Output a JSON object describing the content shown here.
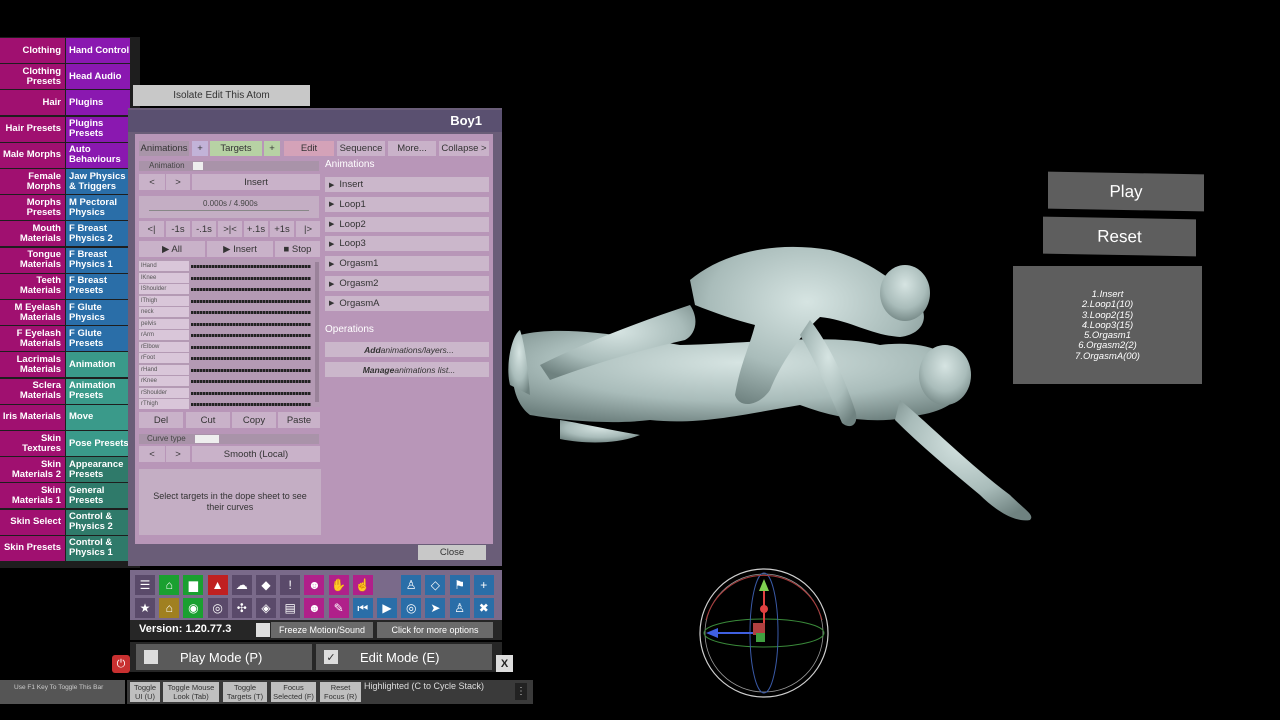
{
  "category_menu": [
    {
      "left": "Clothing",
      "right": "Hand Control",
      "right_color": "#8a18b0"
    },
    {
      "left": "Clothing Presets",
      "right": "Head Audio",
      "right_color": "#8a18b0"
    },
    {
      "left": "Hair",
      "right": "Plugins",
      "right_color": "#8a18b0"
    },
    {
      "left": "Hair Presets",
      "right": "Plugins Presets",
      "right_color": "#8a18b0"
    },
    {
      "left": "Male Morphs",
      "right": "Auto Behaviours",
      "right_color": "#8a18b0"
    },
    {
      "left": "Female Morphs",
      "right": "Jaw Physics & Triggers",
      "right_color": "#2a6ea8"
    },
    {
      "left": "Morphs Presets",
      "right": "M Pectoral Physics",
      "right_color": "#2a6ea8"
    },
    {
      "left": "Mouth Materials",
      "right": "F Breast Physics 2",
      "right_color": "#2a6ea8"
    },
    {
      "left": "Tongue Materials",
      "right": "F Breast Physics 1",
      "right_color": "#2a6ea8"
    },
    {
      "left": "Teeth Materials",
      "right": "F Breast Presets",
      "right_color": "#2a6ea8"
    },
    {
      "left": "M Eyelash Materials",
      "right": "F Glute Physics",
      "right_color": "#2a6ea8"
    },
    {
      "left": "F Eyelash Materials",
      "right": "F Glute Presets",
      "right_color": "#2a6ea8"
    },
    {
      "left": "Lacrimals Materials",
      "right": "Animation",
      "right_color": "#3a9a8a"
    },
    {
      "left": "Sclera Materials",
      "right": "Animation Presets",
      "right_color": "#3a9a8a"
    },
    {
      "left": "Iris Materials",
      "right": "Move",
      "right_color": "#3a9a8a"
    },
    {
      "left": "Skin Textures",
      "right": "Pose Presets",
      "right_color": "#3a9a8a"
    },
    {
      "left": "Skin Materials 2",
      "right": "Appearance Presets",
      "right_color": "#2f7a6a"
    },
    {
      "left": "Skin Materials 1",
      "right": "General Presets",
      "right_color": "#2f7a6a"
    },
    {
      "left": "Skin Select",
      "right": "Control & Physics 2",
      "right_color": "#2f7a6a"
    },
    {
      "left": "Skin Presets",
      "right": "Control & Physics 1",
      "right_color": "#2f7a6a"
    }
  ],
  "isolate_label": "Isolate Edit This Atom",
  "panel": {
    "title": "Boy1",
    "tabs": [
      "Animations",
      "+",
      "Targets",
      "+",
      "Edit",
      "Sequence",
      "More...",
      "Collapse >"
    ],
    "animation_label": "Animation",
    "prev": "<",
    "next": ">",
    "insert": "Insert",
    "time": "0.000s / 4.900s",
    "scrub_buttons": [
      "<|",
      "-1s",
      "-.1s",
      ">|<",
      "+.1s",
      "+1s",
      "|>"
    ],
    "play_all": "▶ All",
    "play_insert": "▶ Insert",
    "stop": "■ Stop",
    "dope_rows": [
      "lHand",
      "lKnee",
      "lShoulder",
      "lThigh",
      "neck",
      "pelvis",
      "rArm",
      "rElbow",
      "rFoot",
      "rHand",
      "rKnee",
      "rShoulder",
      "rThigh"
    ],
    "edit_buttons": [
      "Del",
      "Cut",
      "Copy",
      "Paste"
    ],
    "curve_type_label": "Curve type",
    "curve_value": "Smooth (Local)",
    "info_text": "Select targets in the dope sheet to see their curves",
    "animations_heading": "Animations",
    "animations": [
      "Insert",
      "Loop1",
      "Loop2",
      "Loop3",
      "Orgasm1",
      "Orgasm2",
      "OrgasmA"
    ],
    "operations_heading": "Operations",
    "op_add_em": "Add",
    "op_add_rest": " animations/layers...",
    "op_manage_em": "Manage",
    "op_manage_rest": " animations list...",
    "close": "Close"
  },
  "toolbar": {
    "row1": [
      {
        "name": "menu-icon",
        "glyph": "☰",
        "color": "#5a4a6a"
      },
      {
        "name": "open-scene-icon",
        "glyph": "⌂",
        "color": "#1aa030"
      },
      {
        "name": "folder-icon",
        "glyph": "▆",
        "color": "#1aa030"
      },
      {
        "name": "load-red-icon",
        "glyph": "▲",
        "color": "#c02020"
      },
      {
        "name": "cloud-icon",
        "glyph": "☁",
        "color": "#5a4a6a"
      },
      {
        "name": "cube-icon",
        "glyph": "◆",
        "color": "#5a4a6a"
      },
      {
        "name": "alert-icon",
        "glyph": "!",
        "color": "#5a4a6a"
      },
      {
        "name": "person-select-icon",
        "glyph": "☻",
        "color": "#b0208a"
      },
      {
        "name": "hand-icon",
        "glyph": "✋",
        "color": "#b0208a"
      },
      {
        "name": "pointer-hand-icon",
        "glyph": "☝",
        "color": "#b0208a"
      },
      {
        "name": "spacer",
        "glyph": "",
        "color": "transparent"
      },
      {
        "name": "person-icon",
        "glyph": "♙",
        "color": "#2a6ea8"
      },
      {
        "name": "unity-icon",
        "glyph": "◇",
        "color": "#2a6ea8"
      },
      {
        "name": "flag-icon",
        "glyph": "⚑",
        "color": "#2a6ea8"
      },
      {
        "name": "add-icon",
        "glyph": "+",
        "color": "#2a6ea8"
      }
    ],
    "row2": [
      {
        "name": "star-icon",
        "glyph": "★",
        "color": "#5a4a6a"
      },
      {
        "name": "save-scene-icon",
        "glyph": "⌂",
        "color": "#a08020"
      },
      {
        "name": "camera-green-icon",
        "glyph": "◉",
        "color": "#1aa030"
      },
      {
        "name": "camera-icon",
        "glyph": "◎",
        "color": "#5a4a6a"
      },
      {
        "name": "graph-icon",
        "glyph": "✣",
        "color": "#5a4a6a"
      },
      {
        "name": "box-icon",
        "glyph": "◈",
        "color": "#5a4a6a"
      },
      {
        "name": "document-icon",
        "glyph": "▤",
        "color": "#5a4a6a"
      },
      {
        "name": "person-edit-icon",
        "glyph": "☻",
        "color": "#b0208a"
      },
      {
        "name": "pen-icon",
        "glyph": "✎",
        "color": "#b0208a"
      },
      {
        "name": "skip-back-icon",
        "glyph": "⏮",
        "color": "#2a6ea8"
      },
      {
        "name": "play-icon",
        "glyph": "▶",
        "color": "#2a6ea8"
      },
      {
        "name": "target-icon",
        "glyph": "◎",
        "color": "#2a6ea8"
      },
      {
        "name": "cursor-icon",
        "glyph": "➤",
        "color": "#2a6ea8"
      },
      {
        "name": "people-icon",
        "glyph": "♙",
        "color": "#2a6ea8"
      },
      {
        "name": "tools-icon",
        "glyph": "✖",
        "color": "#2a6ea8"
      }
    ]
  },
  "version": "Version: 1.20.77.3",
  "freeze_label": "Freeze Motion/Sound",
  "more_options": "Click for more options",
  "play_mode": "Play Mode (P)",
  "edit_mode": "Edit Mode (E)",
  "edit_check": "✓",
  "close_x": "X",
  "f1_hint": "Use F1 Key To Toggle This Bar",
  "bottom_buttons": [
    "Toggle UI (U)",
    "Toggle Mouse Look (Tab)",
    "Toggle Targets (T)",
    "Focus Selected (F)",
    "Reset Focus (R)"
  ],
  "highlighted": "Highlighted (C to Cycle Stack)",
  "scene_play": "Play",
  "scene_reset": "Reset",
  "scene_list": [
    "1.Insert",
    "2.Loop1(10)",
    "3.Loop2(15)",
    "4.Loop3(15)",
    "5.Orgasm1",
    "6.Orgasm2(2)",
    "7.OrgasmA(00)"
  ]
}
